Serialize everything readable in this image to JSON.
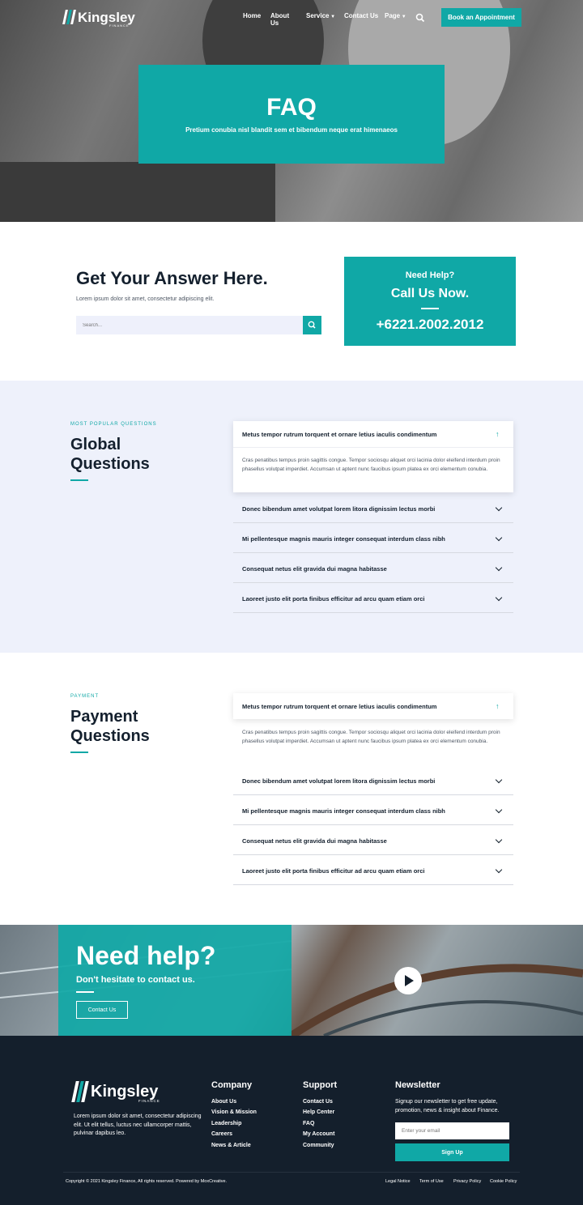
{
  "brand": {
    "name": "Kingsley",
    "tagline": "FINANCE"
  },
  "nav": {
    "items": [
      "Home",
      "About Us",
      "Service",
      "Contact Us",
      "Page"
    ],
    "cta": "Book an Appointment"
  },
  "hero": {
    "title": "FAQ",
    "subtitle": "Pretium conubia nisl blandit sem et bibendum neque erat himenaeos"
  },
  "answer": {
    "title": "Get Your Answer Here.",
    "desc": "Lorem ipsum dolor sit amet, consectetur adipiscing elit.",
    "search_placeholder": "Search..."
  },
  "call": {
    "need_help": "Need Help?",
    "call_now": "Call Us Now.",
    "phone": "+6221.2002.2012"
  },
  "global": {
    "eyebrow": "MOST POPULAR QUESTIONS",
    "title_line1": "Global",
    "title_line2": "Questions",
    "open_question": "Metus tempor rutrum torquent et ornare letius iaculis condimentum",
    "open_answer": "Cras penatibus tempus proin sagittis congue. Tempor sociosqu aliquet orci lacinia dolor eleifend interdum proin phasellus volutpat imperdiet. Accumsan ut aptent nunc faucibus ipsum platea ex orci elementum conubia.",
    "questions": [
      "Donec bibendum amet volutpat lorem litora dignissim lectus morbi",
      "Mi pellentesque magnis mauris integer consequat interdum class nibh",
      "Consequat netus elit gravida dui magna habitasse",
      "Laoreet justo elit porta finibus efficitur ad arcu quam etiam orci"
    ]
  },
  "payment": {
    "eyebrow": "PAYMENT",
    "title_line1": "Payment",
    "title_line2": "Questions",
    "open_question": "Metus tempor rutrum torquent et ornare letius iaculis condimentum",
    "open_answer": "Cras penatibus tempus proin sagittis congue. Tempor sociosqu aliquet orci lacinia dolor eleifend interdum proin phasellus volutpat imperdiet. Accumsan ut aptent nunc faucibus ipsum platea ex orci elementum conubia.",
    "questions": [
      "Donec bibendum amet volutpat lorem litora dignissim lectus morbi",
      "Mi pellentesque magnis mauris integer consequat interdum class nibh",
      "Consequat netus elit gravida dui magna habitasse",
      "Laoreet justo elit porta finibus efficitur ad arcu quam etiam orci"
    ]
  },
  "help_banner": {
    "title": "Need help?",
    "subtitle": "Don't hesitate to contact us.",
    "button": "Contact Us"
  },
  "footer": {
    "about": "Lorem ipsum dolor sit amet, consectetur adipiscing elit. Ut elit tellus, luctus nec ullamcorper mattis, pulvinar dapibus leo.",
    "company": {
      "title": "Company",
      "links": [
        "About Us",
        "Vision & Mission",
        "Leadership",
        "Careers",
        "News & Article"
      ]
    },
    "support": {
      "title": "Support",
      "links": [
        "Contact Us",
        "Help Center",
        "FAQ",
        "My Account",
        "Community"
      ]
    },
    "newsletter": {
      "title": "Newsletter",
      "desc": "Signup our newsletter to get free update, promotion, news & insight about Finance.",
      "placeholder": "Enter your email",
      "button": "Sign Up"
    },
    "copyright": "Copyright © 2021 Kingsley Finance, All rights reserved. Powered by MoxCreative.",
    "legal": [
      "Legal Notice",
      "Term of Use",
      "Privacy Policy",
      "Cookie Policy"
    ]
  },
  "colors": {
    "accent": "#10a8a6",
    "dark": "#141f2c",
    "light_bg": "#eef1fb"
  }
}
